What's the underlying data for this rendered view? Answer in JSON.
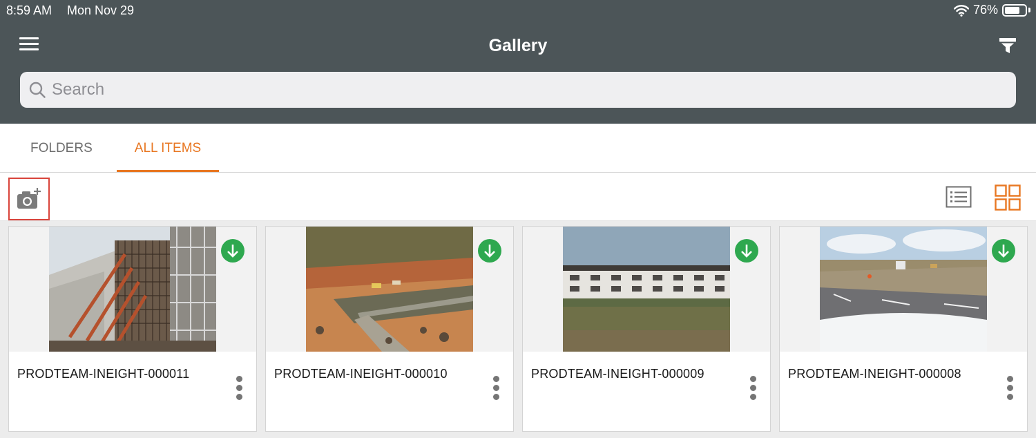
{
  "status_bar": {
    "time": "8:59 AM",
    "date": "Mon Nov 29",
    "battery": "76%",
    "battery_level": 0.76
  },
  "header": {
    "title": "Gallery"
  },
  "search": {
    "placeholder": "Search"
  },
  "tabs": [
    {
      "label": "FOLDERS",
      "active": false
    },
    {
      "label": "ALL ITEMS",
      "active": true
    }
  ],
  "colors": {
    "header_bg": "#4c5558",
    "accent": "#e87722",
    "download_badge": "#2ea84f",
    "highlight_border": "#d9443b"
  },
  "icons": {
    "menu": "hamburger-menu-icon",
    "filter": "filter-icon",
    "search": "search-icon",
    "add_photo": "camera-plus-icon",
    "list_view": "list-view-icon",
    "grid_view": "grid-view-icon",
    "download": "download-arrow-icon",
    "more": "vertical-ellipsis-icon"
  },
  "items": [
    {
      "name": "PRODTEAM-INEIGHT-000011",
      "downloaded": true
    },
    {
      "name": "PRODTEAM-INEIGHT-000010",
      "downloaded": true
    },
    {
      "name": "PRODTEAM-INEIGHT-000009",
      "downloaded": true
    },
    {
      "name": "PRODTEAM-INEIGHT-000008",
      "downloaded": true
    }
  ]
}
